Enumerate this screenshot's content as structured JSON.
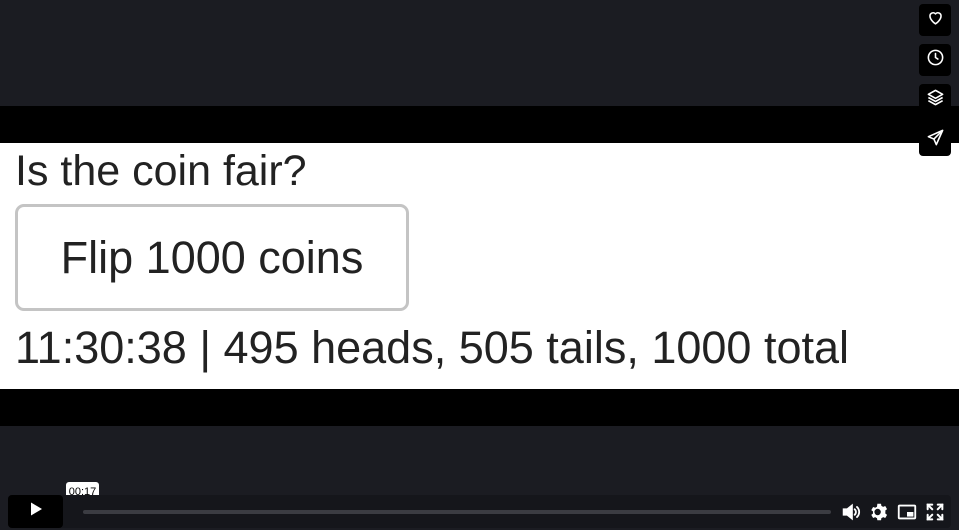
{
  "page": {
    "question": "Is the coin fair?",
    "flip_button_label": "Flip 1000 coins",
    "result_line": "11:30:38 | 495 heads, 505 tails, 1000 total"
  },
  "sidebar_icons": [
    "heart-icon",
    "clock-icon",
    "layers-icon",
    "send-icon"
  ],
  "player": {
    "time_tooltip": "00:17",
    "progress": 0.0,
    "control_icons": [
      "play-icon",
      "volume-icon",
      "settings-icon",
      "pip-icon",
      "fullscreen-icon"
    ]
  },
  "colors": {
    "background": "#1b1c22",
    "letterbox": "#000000",
    "content_bg": "#ffffff",
    "text": "#222222"
  }
}
